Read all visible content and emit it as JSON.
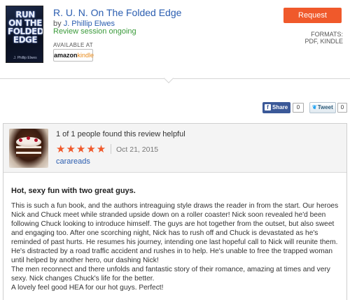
{
  "book": {
    "title": "R. U. N. On The Folded Edge",
    "author_prefix": "by ",
    "author": "J. Phillip Elwes",
    "status": "Review session ongoing",
    "available_at": "AVAILABLE AT",
    "retailer_badge": {
      "brand": "amazon",
      "product": "kindle"
    },
    "cover": {
      "title_art": "RUN ON THE FOLDED EDGE",
      "author_art": "J. Phillip Elwes"
    },
    "request_label": "Request",
    "formats_label": "FORMATS:",
    "formats_value": "PDF, KINDLE"
  },
  "share": {
    "facebook_label": "Share",
    "facebook_count": "0",
    "tweet_label": "Tweet",
    "tweet_count": "0"
  },
  "review": {
    "helpful_text": "1 of 1 people found this review helpful",
    "rating": 5,
    "stars": "★★★★★",
    "date": "Oct 21, 2015",
    "reviewer": "carareads",
    "title": "Hot, sexy fun with two great guys.",
    "body": [
      "This is such a fun book, and the authors intreaguing style draws the reader in from the start. Our heroes Nick and Chuck meet while stranded upside down on a roller coaster! Nick soon revealed he'd been following Chuck looking to introduce himself. The guys are hot together from the outset, but also sweet and engaging too. After one scorching night, Nick has to rush off and Chuck is devastated as he's reminded of past hurts. He resumes his journey, intending one last hopeful call to Nick will reunite them. He's distracted by a road traffic accident and rushes in to help. He's unable to free the trapped woman until helped by another hero, our dashing Nick!",
      "The men reconnect and there unfolds and fantastic story of their romance, amazing at times and very sexy. Nick changes Chuck's life for the better.",
      "A lovely feel good HEA for our hot guys. Perfect!"
    ]
  },
  "colors": {
    "accent": "#f0592b",
    "link": "#2a5db0",
    "status_green": "#3a9a3a",
    "facebook": "#3b5998"
  },
  "icons": [
    "facebook-icon",
    "twitter-bird-icon",
    "star-icon"
  ]
}
